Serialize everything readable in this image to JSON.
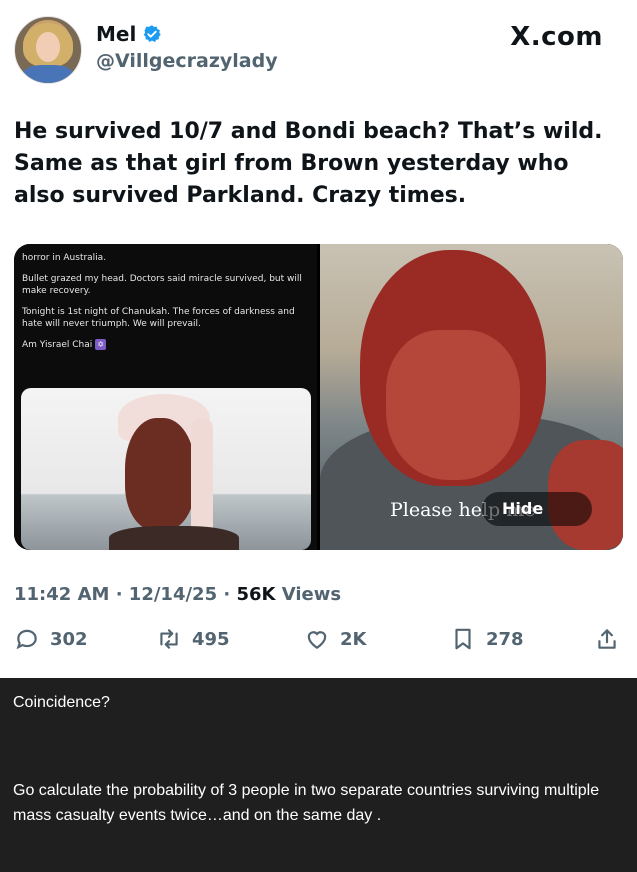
{
  "header": {
    "name": "Mel",
    "handle": "@Villgecrazylady",
    "source": "X.com"
  },
  "tweet": {
    "text": "He survived 10/7 and Bondi beach? That’s wild. Same as that girl from Brown yesterday who also survived Parkland. Crazy times."
  },
  "media": {
    "left_post_lines": [
      "horror in Australia.",
      "Bullet grazed my head. Doctors said miracle survived, but will make recovery.",
      "Tonight is 1st night of Chanukah. The forces of darkness and hate will never triumph. We will prevail.",
      "Am Yisrael Chai"
    ],
    "right_caption": "Please help me",
    "hide_label": "Hide"
  },
  "meta": {
    "time": "11:42 AM",
    "date": "12/14/25",
    "views_count": "56K",
    "views_label": "Views"
  },
  "actions": {
    "replies": "302",
    "reposts": "495",
    "likes": "2K",
    "bookmarks": "278"
  },
  "comment": {
    "line1": "Coincidence?",
    "line2": "Go calculate the probability of 3 people in two separate countries surviving multiple mass casualty events twice…and on the same day ."
  },
  "colors": {
    "verified": "#1d9bf0",
    "secondary_text": "#536471",
    "comment_bg": "#1f1f1f"
  },
  "icons": [
    "verified-badge-icon",
    "reply-icon",
    "repost-icon",
    "like-icon",
    "bookmark-icon",
    "share-icon"
  ]
}
